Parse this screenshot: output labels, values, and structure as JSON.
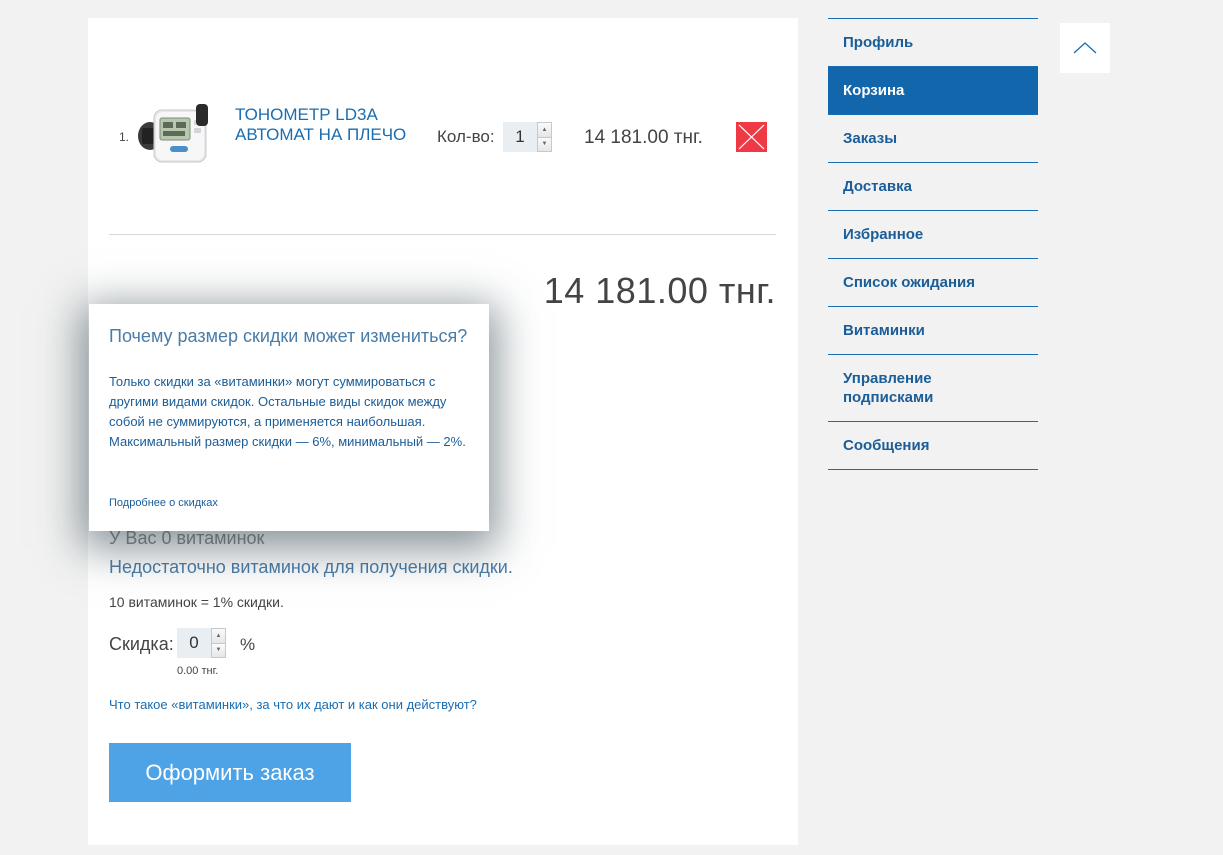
{
  "cart": {
    "items": [
      {
        "number": "1.",
        "title": "Тонометр LD3A автомат на плечо",
        "qty_label": "Кол-во:",
        "qty": "1",
        "price": "14 181.00 тнг."
      }
    ],
    "total": "14 181.00 тнг.",
    "vitamins_count": "У Вас 0 витаминок",
    "not_enough": "Недостаточно витаминок для получения скидки.",
    "rate_text": "10 витаминок = 1% скидки.",
    "discount_label": "Скидка:",
    "discount_value": "0",
    "percent_sign": "%",
    "discount_amount": "0.00 тнг.",
    "vitamins_info_link": "Что такое «витаминки», за что их дают и как они действуют?",
    "checkout_label": "Оформить заказ"
  },
  "popup": {
    "title": "Почему размер скидки может измениться?",
    "body": "Только скидки за «витаминки» могут суммироваться с другими видами скидок. Остальные виды скидок между собой не суммируются, а применяется наибольшая. Максимальный размер скидки — 6%, минимальный — 2%.",
    "link": "Подробнее о скидках"
  },
  "menu": {
    "items": [
      {
        "label": "Профиль",
        "active": false
      },
      {
        "label": "Корзина",
        "active": true
      },
      {
        "label": "Заказы",
        "active": false
      },
      {
        "label": "Доставка",
        "active": false
      },
      {
        "label": "Избранное",
        "active": false
      },
      {
        "label": "Список ожидания",
        "active": false
      },
      {
        "label": "Витаминки",
        "active": false
      },
      {
        "label": "Управление подписками",
        "active": false
      },
      {
        "label": "Сообщения",
        "active": false
      }
    ]
  },
  "icons": {
    "remove": "close-icon",
    "scroll_top": "chevron-up-icon",
    "stepper_up": "arrow-up-icon",
    "stepper_down": "arrow-down-icon"
  },
  "colors": {
    "accent": "#1266ab",
    "link": "#1a6db0",
    "checkout": "#4da3e6",
    "remove": "#ef3a45"
  }
}
